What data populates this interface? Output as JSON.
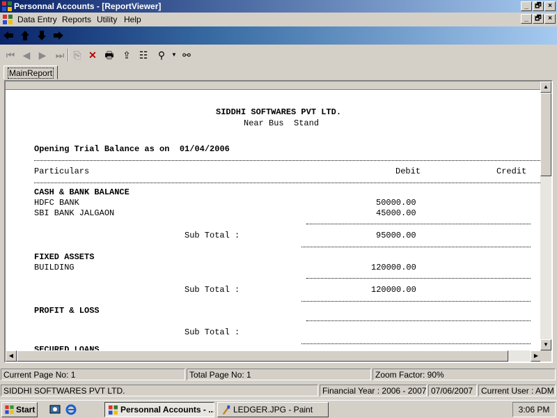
{
  "window": {
    "title": "Personnal Accounts - [ReportViewer]",
    "caption_buttons": [
      "_",
      "🗗",
      "×"
    ]
  },
  "menu": {
    "items": [
      {
        "label": "Data Entry"
      },
      {
        "label": "Reports"
      },
      {
        "label": "Utility"
      },
      {
        "label": "Help"
      }
    ]
  },
  "nav": {
    "icons": [
      "arrow-left-icon",
      "arrow-up-icon",
      "arrow-down-icon",
      "arrow-right-icon"
    ]
  },
  "toolbar": {
    "icons": [
      "first-page-icon",
      "previous-page-icon",
      "next-page-icon",
      "last-page-icon",
      "goto-page-icon",
      "close-report-icon",
      "print-icon",
      "export-icon",
      "group-tree-icon",
      "zoom-icon",
      "search-binoculars-icon"
    ]
  },
  "tab": {
    "label": "MainReport"
  },
  "report": {
    "company": "SIDDHI SOFTWARES PVT LTD.",
    "address": "Near Bus  Stand",
    "heading": "Opening Trial Balance as on  01/04/2006",
    "columns": {
      "particulars": "Particulars",
      "debit": "Debit",
      "credit": "Credit"
    },
    "groups": [
      {
        "name": "CASH & BANK BALANCE",
        "rows": [
          {
            "particular": "HDFC BANK",
            "debit": "50000.00"
          },
          {
            "particular": "SBI BANK JALGAON",
            "debit": "45000.00"
          }
        ],
        "subtotal_label": "Sub Total :",
        "subtotal_debit": "95000.00"
      },
      {
        "name": "FIXED ASSETS",
        "rows": [
          {
            "particular": "BUILDING",
            "debit": "120000.00"
          }
        ],
        "subtotal_label": "Sub Total :",
        "subtotal_debit": "120000.00"
      },
      {
        "name": "PROFIT & LOSS",
        "rows": [],
        "subtotal_label": "Sub Total :",
        "subtotal_debit": ""
      }
    ],
    "cut_off_next": "SECURED LOANS"
  },
  "status": {
    "current_page": "Current Page No: 1",
    "total_page": "Total Page No: 1",
    "zoom": "Zoom Factor: 90%"
  },
  "app_status": {
    "company": "SIDDHI SOFTWARES PVT LTD.",
    "financial_year": "Financial Year : 2006 - 2007",
    "date": "07/06/2007",
    "user": "Current User : ADM"
  },
  "taskbar": {
    "start": "Start",
    "tasks": [
      {
        "label": "Personnal Accounts - ..."
      },
      {
        "label": "LEDGER.JPG - Paint"
      }
    ],
    "clock": "3:06 PM"
  }
}
